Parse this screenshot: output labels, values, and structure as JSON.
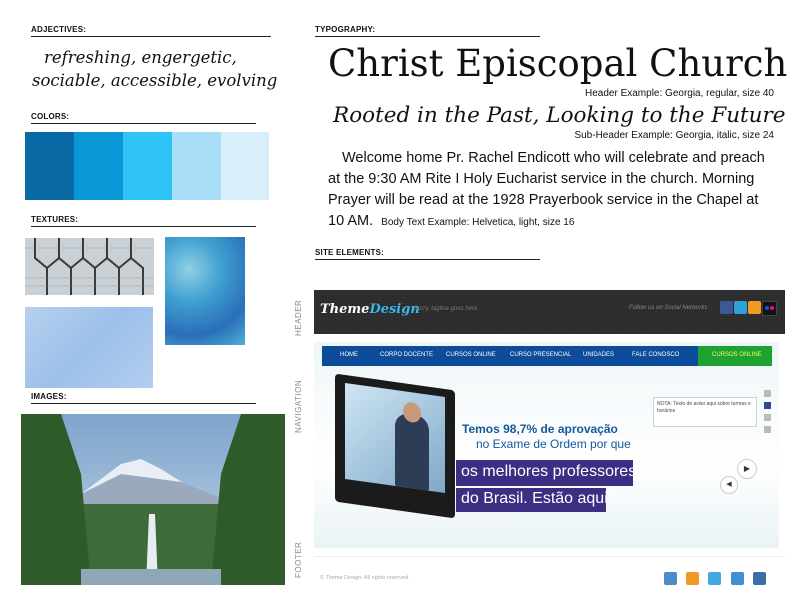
{
  "left": {
    "adjectives_label": "ADJECTIVES:",
    "adjectives_line1": "refreshing, engergetic,",
    "adjectives_line2": "sociable, accessible, evolving",
    "colors_label": "COLORS:",
    "colors": [
      "#0a6aa6",
      "#0a97d6",
      "#2ec5f6",
      "#a8def8",
      "#d7eefb"
    ],
    "textures_label": "TEXTURES:",
    "images_label": "IMAGES:"
  },
  "typography": {
    "label": "TYPOGRAPHY:",
    "header_example": "Christ Episcopal Church",
    "header_note": "Header Example: Georgia, regular, size 40",
    "subheader_example": "Rooted in the Past, Looking to the Future",
    "subheader_note": "Sub-Header Example: Georgia, italic, size 24",
    "body_example": "Welcome home Pr. Rachel Endicott who will celebrate and preach at the 9:30 AM Rite I Holy Eucharist service in the church. Morning Prayer will be read at the 1928 Prayerbook service in the Chapel at 10 AM.",
    "body_note": "Body Text Example: Helvetica, light, size 16"
  },
  "site_elements": {
    "label": "SITE ELEMENTS:",
    "side_labels": {
      "header": "HEADER",
      "navigation": "NAVIGATION",
      "footer": "FOOTER"
    },
    "header": {
      "logo_theme": "Theme",
      "logo_design": "Design",
      "tagline": "Sorry, tagline goes here",
      "follow_text": "Follow us on Social Networks",
      "social_icons": [
        "facebook-icon",
        "twitter-icon",
        "rss-icon",
        "flickr-icon"
      ]
    },
    "nav": {
      "items": [
        "HOME",
        "CORPO DOCENTE",
        "CURSOS ONLINE",
        "CURSO PRESENCIAL",
        "UNIDADES",
        "FALE CONOSCO"
      ],
      "highlight": "CURSOS ONLINE"
    },
    "banner": {
      "headline1": "Temos 98,7% de aprovação",
      "headline2": "no Exame de Ordem por que",
      "tagline1": "os melhores professores",
      "tagline2": "do Brasil. Estão aqui!",
      "note": "NOTA: Texto de aviso aqui sobre turmas e horários"
    },
    "footer": {
      "copyright": "© Theme Design. All rights reserved.",
      "social_icons": [
        "linkedin-icon",
        "rss-icon",
        "twitter-icon",
        "google-icon",
        "facebook-icon"
      ]
    }
  }
}
